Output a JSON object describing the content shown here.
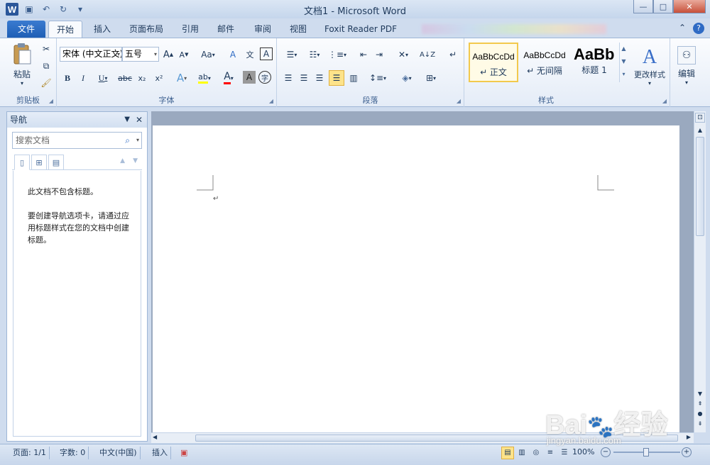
{
  "window": {
    "title": "文档1 - Microsoft Word",
    "app_icon_letter": "W",
    "controls": {
      "minimize": "—",
      "maximize": "□",
      "close": "✕"
    }
  },
  "quick_access": {
    "undo_icon": "↶",
    "redo_icon": "↻",
    "save_icon": "▣",
    "customize_icon": "▾"
  },
  "tabs": {
    "file": "文件",
    "home": "开始",
    "insert": "插入",
    "layout": "页面布局",
    "references": "引用",
    "mailings": "邮件",
    "review": "审阅",
    "view": "视图",
    "foxit": "Foxit Reader PDF",
    "minimize_ribbon_icon": "⌃",
    "help_icon": "?"
  },
  "ribbon": {
    "clipboard": {
      "label": "剪贴板",
      "paste": "粘贴"
    },
    "font": {
      "label": "字体",
      "font_name": "宋体 (中文正文)",
      "font_size": "五号",
      "grow": "A",
      "shrink": "A",
      "case": "Aa",
      "clear": "A",
      "phonetic": "文",
      "border_char": "A",
      "bold": "B",
      "italic": "I",
      "underline": "U",
      "strike": "abc",
      "subscript": "x₂",
      "superscript": "x²",
      "text_effect": "A",
      "highlight": "ab",
      "font_color": "A",
      "shade": "A",
      "enclose": "字"
    },
    "paragraph": {
      "label": "段落"
    },
    "styles": {
      "label": "样式",
      "items": [
        {
          "sample": "AaBbCcDd",
          "name": "↵ 正文"
        },
        {
          "sample": "AaBbCcDd",
          "name": "↵ 无间隔"
        },
        {
          "sample": "AaBb",
          "name": "标题 1"
        }
      ],
      "change": "更改样式"
    },
    "editing": {
      "label": "编辑"
    }
  },
  "nav": {
    "title": "导航",
    "search_placeholder": "搜索文档",
    "msg1": "此文档不包含标题。",
    "msg2": "要创建导航选项卡，请通过应用标题样式在您的文档中创建标题。"
  },
  "status": {
    "page": "页面: 1/1",
    "words": "字数: 0",
    "lang": "中文(中国)",
    "mode": "插入",
    "zoom": "100%"
  },
  "watermark": {
    "brand": "Bai",
    "brand2": "经验",
    "url": "jingyan.baidu.com"
  },
  "colors": {
    "accent": "#2b579a",
    "highlight_yellow": "#ffff00",
    "font_red": "#ff0000"
  }
}
